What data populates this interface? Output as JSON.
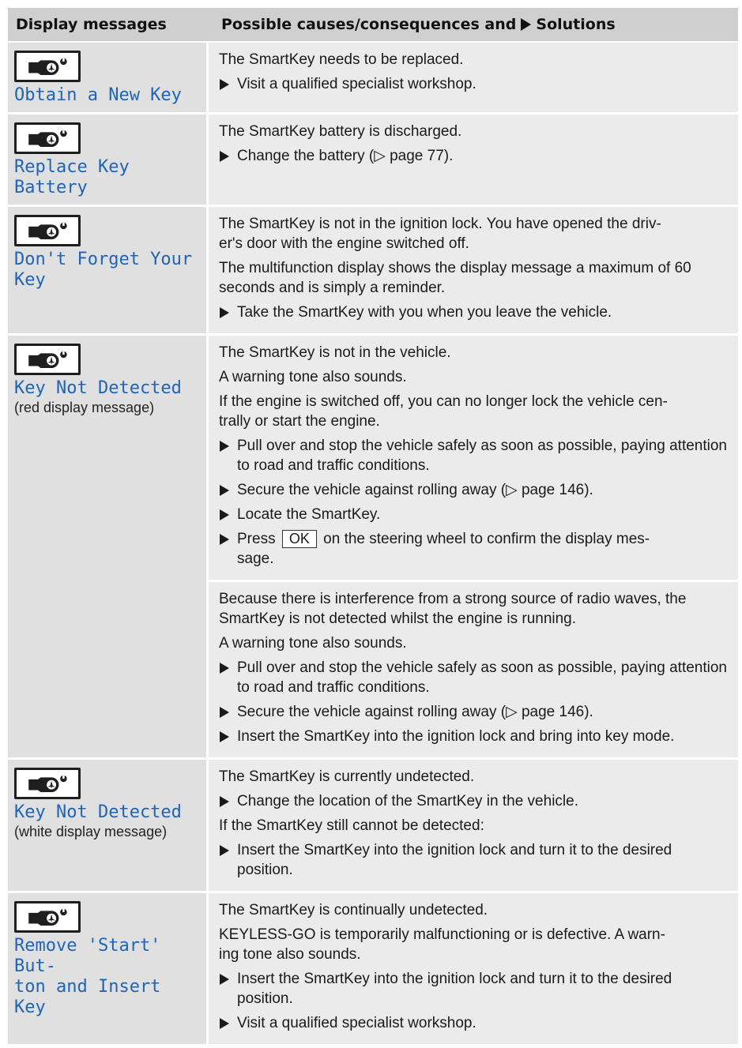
{
  "header": {
    "col1": "Display messages",
    "col2_prefix": "Possible causes/consequences and",
    "col2_suffix": "Solutions"
  },
  "icon": "smartkey-icon",
  "colors": {
    "message_text": "#1f64b5",
    "header_bg": "#cfcfcf",
    "cell_bg": "#ebebeb"
  },
  "rows": [
    {
      "message": "Obtain a New Key",
      "blocks": [
        {
          "p1": "The SmartKey needs to be replaced.",
          "s1": "Visit a qualified specialist workshop."
        }
      ]
    },
    {
      "message": "Replace Key Battery",
      "blocks": [
        {
          "p1": "The SmartKey battery is discharged.",
          "s1": "Change the battery (▷ page 77)."
        }
      ]
    },
    {
      "message": "Don't Forget Your\nKey",
      "blocks": [
        {
          "p1": "The SmartKey is not in the ignition lock. You have opened the driv-\ner's door with the engine switched off.",
          "p2": "The multifunction display shows the display message a maximum of 60 seconds and is simply a reminder.",
          "s1": "Take the SmartKey with you when you leave the vehicle."
        }
      ]
    },
    {
      "message": "Key Not Detected",
      "note": "(red display message)",
      "blocks": [
        {
          "p1": "The SmartKey is not in the vehicle.",
          "p2": "A warning tone also sounds.",
          "p3": "If the engine is switched off, you can no longer lock the vehicle cen-\ntrally or start the engine.",
          "s1": "Pull over and stop the vehicle safely as soon as possible, paying attention to road and traffic conditions.",
          "s2": "Secure the vehicle against rolling away (▷ page 146).",
          "s3": "Locate the SmartKey.",
          "s4_before": "Press",
          "s4_button": "OK",
          "s4_after": "on the steering wheel to confirm the display mes-\nsage."
        },
        {
          "p1": "Because there is interference from a strong source of radio waves, the SmartKey is not detected whilst the engine is running.",
          "p2": "A warning tone also sounds.",
          "s1": "Pull over and stop the vehicle safely as soon as possible, paying attention to road and traffic conditions.",
          "s2": "Secure the vehicle against rolling away (▷ page 146).",
          "s3": "Insert the SmartKey into the ignition lock and bring into key mode."
        }
      ]
    },
    {
      "message": "Key Not Detected",
      "note": "(white display message)",
      "blocks": [
        {
          "p1": "The SmartKey is currently undetected.",
          "s1": "Change the location of the SmartKey in the vehicle.",
          "p2": "If the SmartKey still cannot be detected:",
          "s2": "Insert the SmartKey into the ignition lock and turn it to the desired position."
        }
      ]
    },
    {
      "message": "Remove 'Start' But-\nton and Insert Key",
      "blocks": [
        {
          "p1": "The SmartKey is continually undetected.",
          "p2": "KEYLESS-GO is temporarily malfunctioning or is defective. A warn-\ning tone also sounds.",
          "s1": "Insert the SmartKey into the ignition lock and turn it to the desired position.",
          "s2": "Visit a qualified specialist workshop."
        }
      ]
    }
  ]
}
